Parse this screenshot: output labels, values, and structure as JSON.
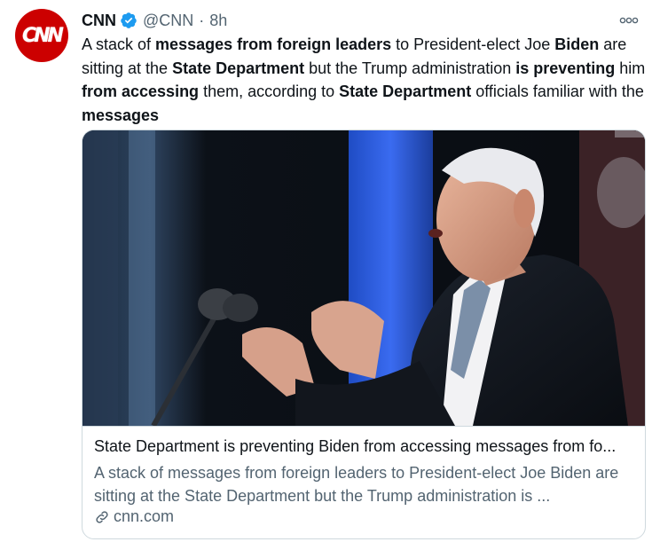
{
  "tweet": {
    "author_name": "CNN",
    "avatar_logo": "CNN",
    "handle": "@CNN",
    "separator": "·",
    "time": "8h",
    "text_segments": [
      {
        "t": "A stack of ",
        "b": false
      },
      {
        "t": "messages from foreign leaders",
        "b": true
      },
      {
        "t": " to President-elect Joe ",
        "b": false
      },
      {
        "t": "Biden",
        "b": true
      },
      {
        "t": " are sitting at the ",
        "b": false
      },
      {
        "t": "State Department",
        "b": true
      },
      {
        "t": " but the Trump administration ",
        "b": false
      },
      {
        "t": "is preventing",
        "b": true
      },
      {
        "t": " him ",
        "b": false
      },
      {
        "t": "from accessing",
        "b": true
      },
      {
        "t": " them, according to ",
        "b": false
      },
      {
        "t": "State Department",
        "b": true
      },
      {
        "t": " officials familiar with the ",
        "b": false
      },
      {
        "t": "messages",
        "b": true
      }
    ]
  },
  "card": {
    "title": "State Department is preventing Biden from accessing messages from fo...",
    "description": "A stack of messages from foreign leaders to President-elect Joe Biden are sitting at the State Department but the Trump administration is ...",
    "domain": "cnn.com"
  },
  "colors": {
    "brand": "#cc0000",
    "verified": "#1d9bf0",
    "secondary_text": "#536471",
    "border": "#cfd9de"
  },
  "icons": {
    "verified": "verified-badge-icon",
    "more": "more-options-icon",
    "link": "link-icon"
  }
}
